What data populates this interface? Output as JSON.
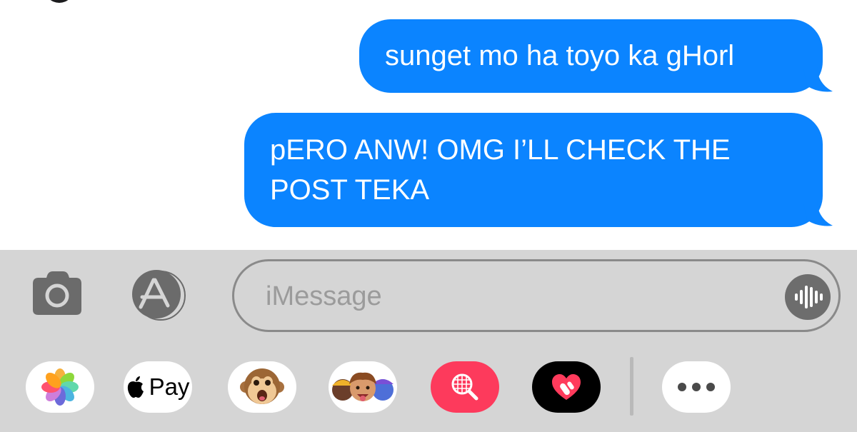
{
  "messages": [
    {
      "text": "sunget mo ha toyo ka gHorl"
    },
    {
      "text": "pERO ANW! OMG I’LL CHECK THE POST TEKA"
    }
  ],
  "compose": {
    "placeholder": "iMessage",
    "icons": [
      "camera-icon",
      "app-store-icon",
      "audio-waveform-icon"
    ]
  },
  "app_drawer": [
    {
      "icon": "photos-icon"
    },
    {
      "icon": "apple-logo-icon",
      "label": "Pay"
    },
    {
      "icon": "monkey-animoji-icon"
    },
    {
      "icon": "memoji-icon"
    },
    {
      "icon": "web-images-search-icon"
    },
    {
      "icon": "digital-touch-icon"
    },
    {
      "icon": "more-apps-icon"
    }
  ],
  "colors": {
    "bubble": "#0b84ff",
    "panel": "#d5d5d5",
    "search_app": "#fd3a5c"
  }
}
